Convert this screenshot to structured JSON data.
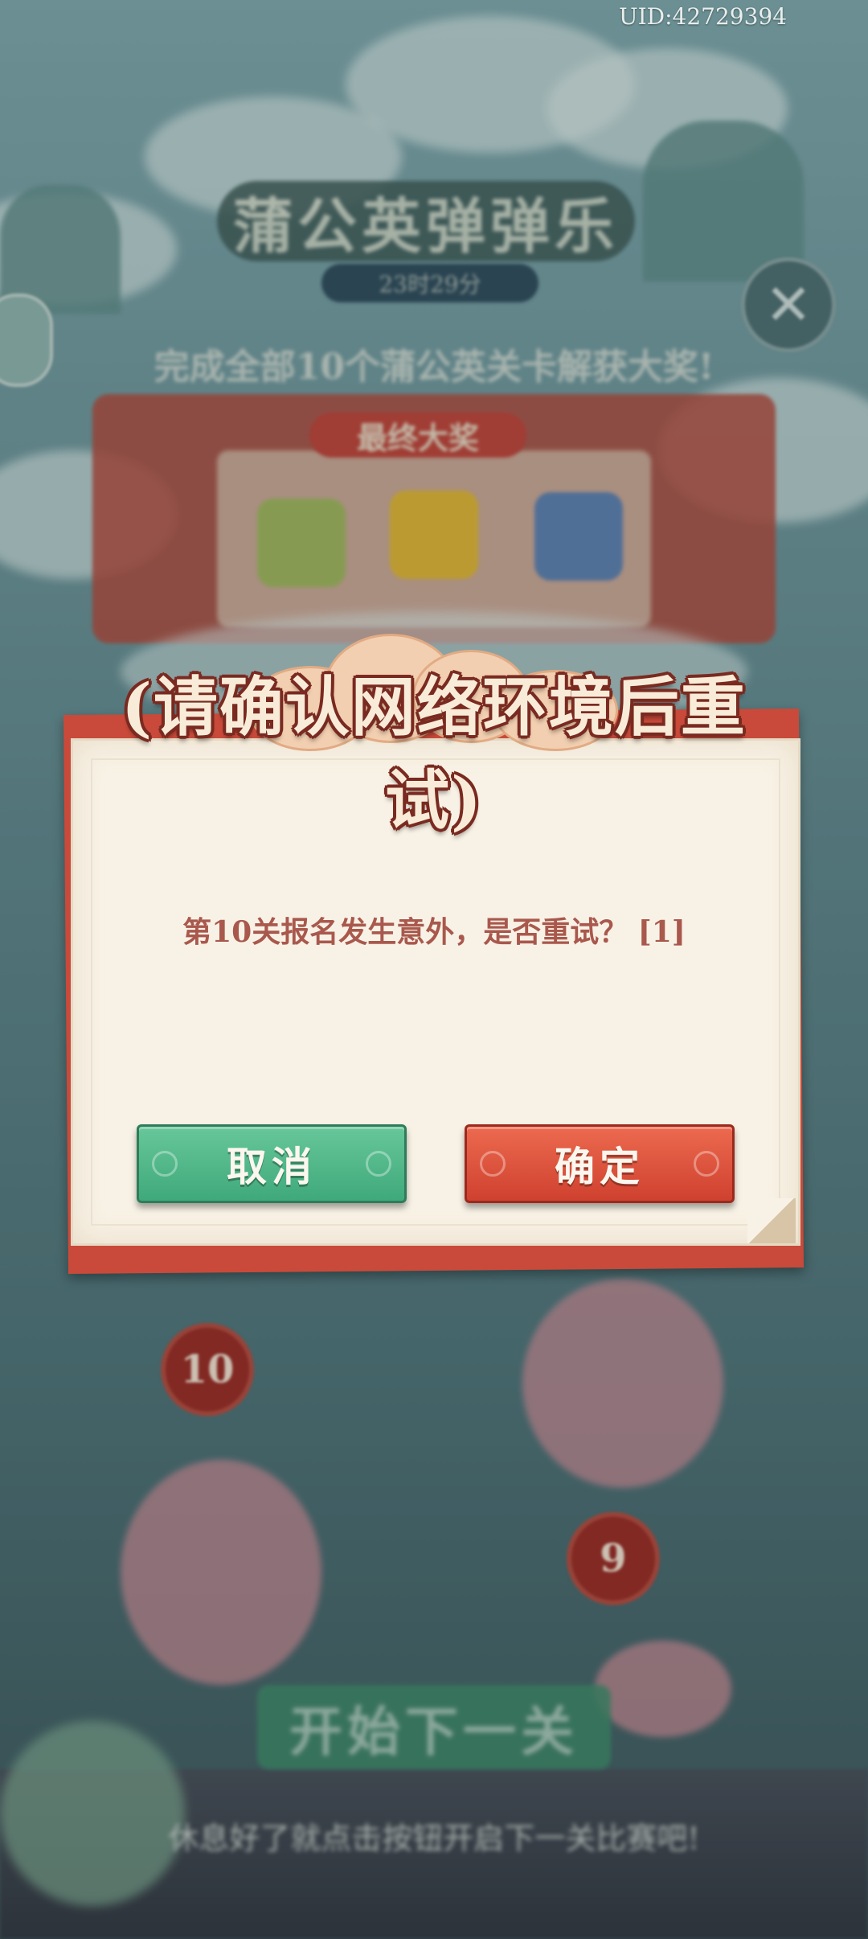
{
  "uid": "UID:42729394",
  "background": {
    "game_title": "蒲公英弹弹乐",
    "event_date": "23时29分",
    "subtitle": "完成全部10个蒲公英关卡解获大奖!",
    "prize_label": "最终大奖",
    "level_nodes": [
      "10",
      "9"
    ],
    "start_button": "开始下一关",
    "hint": "休息好了就点击按钮开启下一关比赛吧!"
  },
  "dialog": {
    "title": "(请确认网络环境后重试)",
    "message": "第10关报名发生意外，是否重试？ [1]",
    "cancel_label": "取消",
    "confirm_label": "确定"
  },
  "colors": {
    "dialog_red": "#c94a3a",
    "paper": "#f8f2e6",
    "message_text": "#a9584d",
    "cancel_green": "#4fb585",
    "confirm_red": "#d9503a"
  }
}
